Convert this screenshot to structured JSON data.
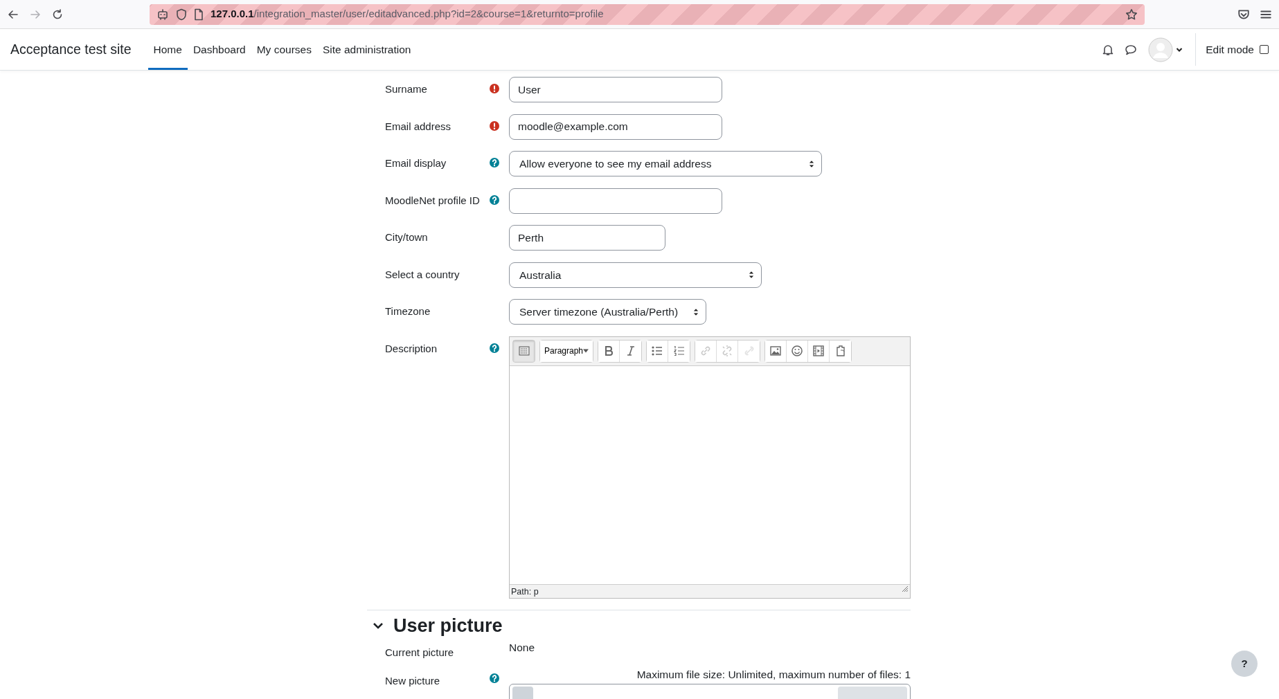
{
  "browser": {
    "url_host": "127.0.0.1",
    "url_path": "/integration_master/user/editadvanced.php?id=2&course=1&returnto=profile",
    "forward_disabled": true
  },
  "navbar": {
    "site_name": "Acceptance test site",
    "items": [
      {
        "label": "Home",
        "selected": true
      },
      {
        "label": "Dashboard",
        "selected": false
      },
      {
        "label": "My courses",
        "selected": false
      },
      {
        "label": "Site administration",
        "selected": false
      }
    ],
    "edit_mode": {
      "label": "Edit mode",
      "on": false
    }
  },
  "fields": [
    {
      "kind": "text",
      "label": "Surname",
      "required": true,
      "help": false,
      "value": "User"
    },
    {
      "kind": "text",
      "label": "Email address",
      "required": true,
      "help": false,
      "value": "moodle@example.com"
    },
    {
      "kind": "select",
      "label": "Email display",
      "required": false,
      "help": true,
      "value": "Allow everyone to see my email address"
    },
    {
      "kind": "text",
      "label": "MoodleNet profile ID",
      "required": false,
      "help": true
    },
    {
      "kind": "text",
      "label": "City/town",
      "required": false,
      "help": false,
      "value": "Perth"
    },
    {
      "kind": "select",
      "label": "Select a country",
      "required": false,
      "help": false,
      "value": "Australia"
    },
    {
      "kind": "select",
      "label": "Timezone",
      "required": false,
      "help": false,
      "value": "Server timezone (Australia/Perth)"
    },
    {
      "kind": "editor",
      "label": "Description",
      "required": false,
      "help": true,
      "path": "Path: p",
      "toolbar": [
        [
          {
            "kind": "toggle",
            "pressed": true,
            "disabled": false
          }
        ],
        [
          {
            "kind": "format",
            "label": "Paragraph"
          }
        ],
        [
          {
            "kind": "bold",
            "pressed": false,
            "disabled": false
          },
          {
            "kind": "italic",
            "pressed": false,
            "disabled": false
          }
        ],
        [
          {
            "kind": "bullets",
            "pressed": false,
            "disabled": false
          },
          {
            "kind": "numbers",
            "pressed": false,
            "disabled": false
          }
        ],
        [
          {
            "kind": "link",
            "pressed": false,
            "disabled": true
          },
          {
            "kind": "unlink",
            "pressed": false,
            "disabled": true
          },
          {
            "kind": "anchor",
            "pressed": false,
            "disabled": true
          }
        ],
        [
          {
            "kind": "image",
            "pressed": false,
            "disabled": false
          },
          {
            "kind": "emoji",
            "pressed": false,
            "disabled": false
          },
          {
            "kind": "media",
            "pressed": false,
            "disabled": false
          },
          {
            "kind": "paste",
            "pressed": false,
            "disabled": false
          }
        ]
      ]
    }
  ],
  "section": {
    "title": "User picture",
    "expanded": true,
    "rows": [
      {
        "kind": "static",
        "label": "Current picture",
        "required": false,
        "help": false,
        "value": "None"
      },
      {
        "kind": "filepicker",
        "label": "New picture",
        "required": false,
        "help": true,
        "note": "Maximum file size: Unlimited, maximum number of files: 1"
      }
    ]
  },
  "help_button": {
    "label": "?"
  }
}
